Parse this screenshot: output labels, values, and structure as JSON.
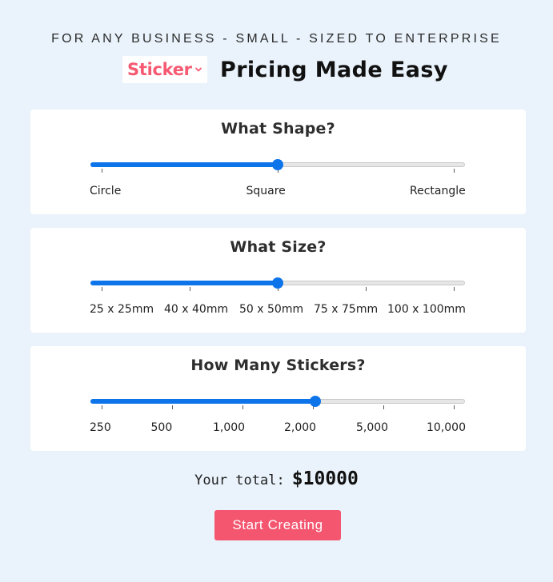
{
  "header": {
    "tagline": "FOR ANY BUSINESS - SMALL - SIZED TO ENTERPRISE",
    "brand_label": "Sticker",
    "brand_icon": "chevron-down-icon",
    "title": "Pricing Made Easy"
  },
  "colors": {
    "background": "#eaf3fb",
    "slider_accent": "#0d74ea",
    "brand": "#f55a72",
    "button": "#f45670"
  },
  "sliders": [
    {
      "title": "What Shape?",
      "value_fraction": 0.5,
      "options": [
        "Circle",
        "Square",
        "Rectangle"
      ]
    },
    {
      "title": "What Size?",
      "value_fraction": 0.5,
      "options": [
        "25 x 25mm",
        "40 x 40mm",
        "50 x 50mm",
        "75 x 75mm",
        "100 x 100mm"
      ]
    },
    {
      "title": "How Many Stickers?",
      "value_fraction": 0.6,
      "options": [
        "250",
        "500",
        "1,000",
        "2,000",
        "5,000",
        "10,000"
      ]
    }
  ],
  "total": {
    "label": "Your total:",
    "value": "$10000"
  },
  "cta": {
    "label": "Start Creating"
  }
}
